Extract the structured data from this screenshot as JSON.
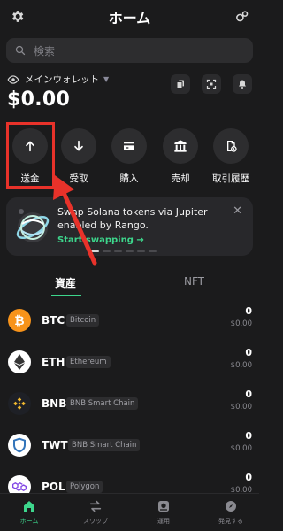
{
  "header": {
    "title": "ホーム"
  },
  "search": {
    "placeholder": "検索"
  },
  "wallet": {
    "name": "メインウォレット",
    "balance": "$0.00"
  },
  "actions": [
    {
      "label": "送金",
      "icon": "arrow-up-icon"
    },
    {
      "label": "受取",
      "icon": "arrow-down-icon"
    },
    {
      "label": "購入",
      "icon": "card-icon"
    },
    {
      "label": "売却",
      "icon": "bank-icon"
    },
    {
      "label": "取引履歴",
      "icon": "history-icon"
    }
  ],
  "banner": {
    "text": "Swap Solana tokens via Jupiter enabled by Rango.",
    "cta": "Start swapping →",
    "close": "✕"
  },
  "tabs": [
    {
      "label": "資産"
    },
    {
      "label": "NFT"
    }
  ],
  "assets": [
    {
      "symbol": "BTC",
      "network": "Bitcoin",
      "amount": "0",
      "usd": "$0.00",
      "color": "#f7931a"
    },
    {
      "symbol": "ETH",
      "network": "Ethereum",
      "amount": "0",
      "usd": "$0.00",
      "color": "#ffffff"
    },
    {
      "symbol": "BNB",
      "network": "BNB Smart Chain",
      "amount": "0",
      "usd": "$0.00",
      "color": "#f3ba2f"
    },
    {
      "symbol": "TWT",
      "network": "BNB Smart Chain",
      "amount": "0",
      "usd": "$0.00",
      "color": "#3375bb"
    },
    {
      "symbol": "POL",
      "network": "Polygon",
      "amount": "0",
      "usd": "$0.00",
      "color": "#8247e5"
    }
  ],
  "nav": [
    {
      "label": "ホーム"
    },
    {
      "label": "スワップ"
    },
    {
      "label": "運用"
    },
    {
      "label": "発見する"
    }
  ],
  "colors": {
    "accent": "#3dd68c",
    "highlight": "#e8322a",
    "background": "#1b1b1c"
  }
}
